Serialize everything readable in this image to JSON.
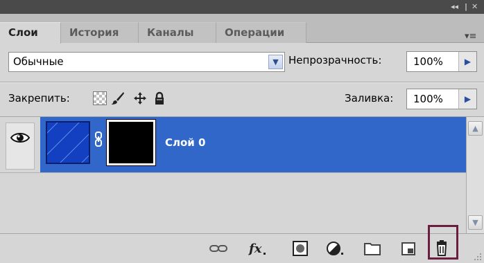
{
  "window": {
    "collapse_glyph": "◂◂",
    "separator_glyph": "|",
    "close_glyph": "✕"
  },
  "tabs": [
    {
      "label": "Слои",
      "active": true
    },
    {
      "label": "История",
      "active": false
    },
    {
      "label": "Каналы",
      "active": false
    },
    {
      "label": "Операции",
      "active": false
    }
  ],
  "panel_menu_glyph": "▾≡",
  "blend": {
    "value": "Обычные",
    "arrow": "▼"
  },
  "opacity": {
    "label": "Непрозрачность:",
    "value": "100%",
    "arrow": "▶"
  },
  "lock": {
    "label": "Закрепить:",
    "icons": [
      "lock-transparent-icon",
      "brush-icon",
      "move-icon",
      "lock-icon"
    ]
  },
  "fill": {
    "label": "Заливка:",
    "value": "100%",
    "arrow": "▶"
  },
  "layers": [
    {
      "name": "Слой 0",
      "visible": true,
      "selected": true,
      "has_mask": true
    }
  ],
  "scrollbar": {
    "up_glyph": "▲",
    "down_glyph": "▼"
  },
  "toolbar": {
    "buttons": [
      "link-icon",
      "fx-icon",
      "mask-icon",
      "adjustment-icon",
      "folder-icon",
      "new-layer-icon",
      "trash-icon"
    ],
    "fx_text": "fx"
  },
  "colors": {
    "selection": "#3167c9",
    "panel_bg": "#d6d6d6",
    "highlight_border": "#6b1d3f"
  }
}
